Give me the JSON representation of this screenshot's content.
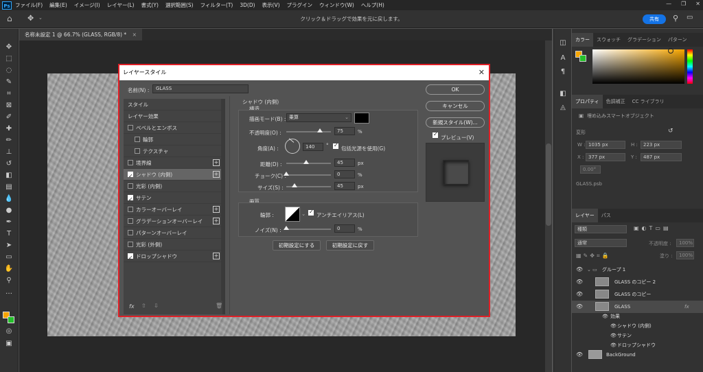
{
  "menubar": {
    "items": [
      "ファイル(F)",
      "編集(E)",
      "イメージ(I)",
      "レイヤー(L)",
      "書式(Y)",
      "選択範囲(S)",
      "フィルター(T)",
      "3D(D)",
      "表示(V)",
      "プラグイン",
      "ウィンドウ(W)",
      "ヘルプ(H)"
    ]
  },
  "optbar": {
    "hint": "クリック＆ドラッグで効果を元に戻します。",
    "share": "共有"
  },
  "document": {
    "tab": "名称未設定 1 @ 66.7% (GLASS, RGB/8) *",
    "tab_close": "×"
  },
  "dialog": {
    "title": "レイヤースタイル",
    "close": "✕",
    "name_label": "名前(N) :",
    "name_value": "GLASS",
    "list": {
      "header": "スタイル",
      "items": [
        {
          "label": "レイヤー効果"
        },
        {
          "label": "ベベルとエンボス"
        },
        {
          "label": "輪郭"
        },
        {
          "label": "テクスチャ"
        },
        {
          "label": "境界線"
        },
        {
          "label": "シャドウ (内側)"
        },
        {
          "label": "光彩 (内側)"
        },
        {
          "label": "サテン"
        },
        {
          "label": "カラーオーバーレイ"
        },
        {
          "label": "グラデーションオーバーレイ"
        },
        {
          "label": "パターンオーバーレイ"
        },
        {
          "label": "光彩 (外側)"
        },
        {
          "label": "ドロップシャドウ"
        }
      ],
      "footer_fx": "fx"
    },
    "inner_shadow": {
      "section": "シャドウ (内側)",
      "structure": "構造",
      "blend_label": "描画モード(B) :",
      "blend_value": "乗算",
      "opacity_label": "不透明度(O) :",
      "opacity": 75,
      "angle_label": "角度(A) :",
      "angle": 140,
      "global_light": "包括光源を使用(G)",
      "distance_label": "距離(D) :",
      "distance": 45,
      "choke_label": "チョーク(C) :",
      "choke": 0,
      "size_label": "サイズ(S) :",
      "size": 45,
      "quality": "画質",
      "contour_label": "輪郭 :",
      "antialias": "アンチエイリアス(L)",
      "noise_label": "ノイズ(N) :",
      "noise": 0,
      "pct": "%",
      "px": "px",
      "deg": "°",
      "reset_default": "初期設定にする",
      "restore_default": "初期設定に戻す"
    },
    "ok": "OK",
    "cancel": "キャンセル",
    "new_style": "新規スタイル(W)...",
    "preview_label": "プレビュー(V)"
  },
  "panels": {
    "color_tabs": [
      "カラー",
      "スウォッチ",
      "グラデーション",
      "パターン"
    ],
    "prop_tabs": [
      "プロパティ",
      "色調補正",
      "CC ライブラリ"
    ],
    "prop_type": "埋め込みスマートオブジェクト",
    "transform": "変形",
    "w_label": "W :",
    "w": "1035 px",
    "h_label": "H :",
    "h": "223 px",
    "x_label": "X :",
    "x": "377 px",
    "y_label": "Y :",
    "y": "487 px",
    "angle": "0.00°",
    "file": "GLASS.psb",
    "layer_tabs": [
      "レイヤー",
      "パス"
    ],
    "search": "種類",
    "blend": "通常",
    "opacity_label": "不透明度 :",
    "opacity": "100%",
    "fill_label": "塗り :",
    "fill": "100%",
    "layers": [
      {
        "name": "グループ 1"
      },
      {
        "name": "GLASS のコピー 2"
      },
      {
        "name": "GLASS のコピー"
      },
      {
        "name": "GLASS"
      },
      {
        "name": "効果"
      },
      {
        "name": "シャドウ (内側)"
      },
      {
        "name": "サテン"
      },
      {
        "name": "ドロップシャドウ"
      },
      {
        "name": "BackGround"
      }
    ]
  },
  "colors": {
    "accent": "#1473e6",
    "highlight": "#e01f26",
    "fg": "#f7a600",
    "bg": "#25c02b"
  }
}
